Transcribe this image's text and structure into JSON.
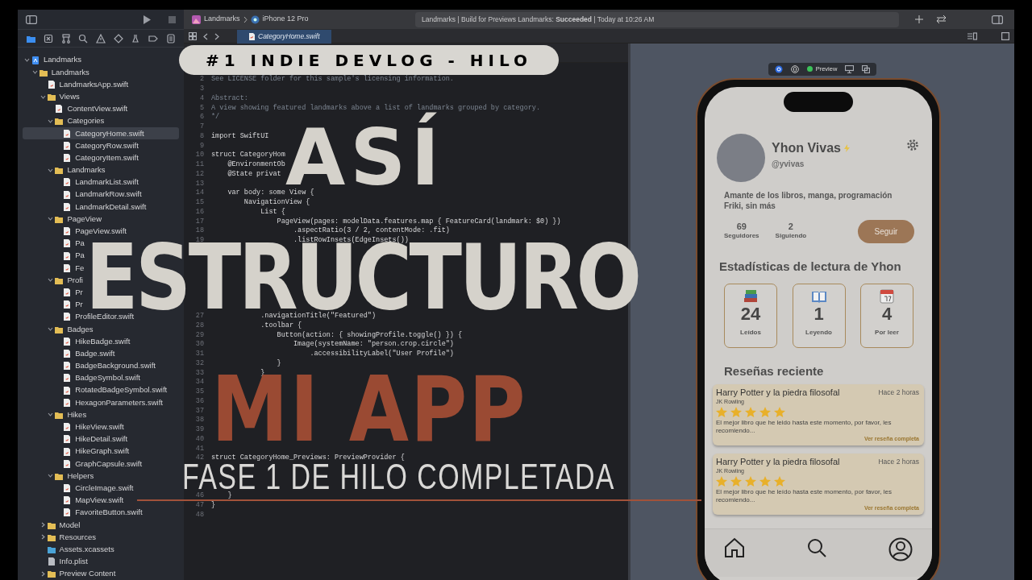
{
  "xcode": {
    "toolbar": {
      "scheme": "Landmarks",
      "device": "iPhone 12 Pro",
      "status": "Landmarks | Build for Previews Landmarks: **Succeeded** | Today at 10:26 AM"
    },
    "navigator": {
      "tree": [
        {
          "name": "Landmarks",
          "kind": "project",
          "expanded": true,
          "selected": false,
          "children": [
            {
              "name": "Landmarks",
              "kind": "folder",
              "expanded": true,
              "selected": false,
              "children": [
                {
                  "name": "LandmarksApp.swift",
                  "kind": "swift",
                  "selected": false
                },
                {
                  "name": "Views",
                  "kind": "folder",
                  "expanded": true,
                  "selected": false,
                  "children": [
                    {
                      "name": "ContentView.swift",
                      "kind": "swift",
                      "selected": false
                    },
                    {
                      "name": "Categories",
                      "kind": "folder",
                      "expanded": true,
                      "selected": false,
                      "children": [
                        {
                          "name": "CategoryHome.swift",
                          "kind": "swift",
                          "selected": true
                        },
                        {
                          "name": "CategoryRow.swift",
                          "kind": "swift",
                          "selected": false
                        },
                        {
                          "name": "CategoryItem.swift",
                          "kind": "swift",
                          "selected": false
                        }
                      ]
                    },
                    {
                      "name": "Landmarks",
                      "kind": "folder",
                      "expanded": true,
                      "selected": false,
                      "children": [
                        {
                          "name": "LandmarkList.swift",
                          "kind": "swift",
                          "selected": false
                        },
                        {
                          "name": "LandmarkRow.swift",
                          "kind": "swift",
                          "selected": false
                        },
                        {
                          "name": "LandmarkDetail.swift",
                          "kind": "swift",
                          "selected": false
                        }
                      ]
                    },
                    {
                      "name": "PageView",
                      "kind": "folder",
                      "expanded": true,
                      "selected": false,
                      "children": [
                        {
                          "name": "PageView.swift",
                          "kind": "swift",
                          "selected": false
                        },
                        {
                          "name": "Pa",
                          "kind": "swift",
                          "selected": false
                        },
                        {
                          "name": "Pa",
                          "kind": "swift",
                          "selected": false
                        },
                        {
                          "name": "Fe",
                          "kind": "swift",
                          "selected": false
                        }
                      ]
                    },
                    {
                      "name": "Profi",
                      "kind": "folder",
                      "expanded": true,
                      "selected": false,
                      "children": [
                        {
                          "name": "Pr",
                          "kind": "swift",
                          "selected": false
                        },
                        {
                          "name": "Pr",
                          "kind": "swift",
                          "selected": false
                        },
                        {
                          "name": "ProfileEditor.swift",
                          "kind": "swift",
                          "selected": false
                        }
                      ]
                    },
                    {
                      "name": "Badges",
                      "kind": "folder",
                      "expanded": true,
                      "selected": false,
                      "children": [
                        {
                          "name": "HikeBadge.swift",
                          "kind": "swift",
                          "selected": false
                        },
                        {
                          "name": "Badge.swift",
                          "kind": "swift",
                          "selected": false
                        },
                        {
                          "name": "BadgeBackground.swift",
                          "kind": "swift",
                          "selected": false
                        },
                        {
                          "name": "BadgeSymbol.swift",
                          "kind": "swift",
                          "selected": false
                        },
                        {
                          "name": "RotatedBadgeSymbol.swift",
                          "kind": "swift",
                          "selected": false
                        },
                        {
                          "name": "HexagonParameters.swift",
                          "kind": "swift",
                          "selected": false
                        }
                      ]
                    },
                    {
                      "name": "Hikes",
                      "kind": "folder",
                      "expanded": true,
                      "selected": false,
                      "children": [
                        {
                          "name": "HikeView.swift",
                          "kind": "swift",
                          "selected": false
                        },
                        {
                          "name": "HikeDetail.swift",
                          "kind": "swift",
                          "selected": false
                        },
                        {
                          "name": "HikeGraph.swift",
                          "kind": "swift",
                          "selected": false
                        },
                        {
                          "name": "GraphCapsule.swift",
                          "kind": "swift",
                          "selected": false
                        }
                      ]
                    },
                    {
                      "name": "Helpers",
                      "kind": "folder",
                      "expanded": true,
                      "selected": false,
                      "children": [
                        {
                          "name": "CircleImage.swift",
                          "kind": "swift",
                          "selected": false
                        },
                        {
                          "name": "MapView.swift",
                          "kind": "swift",
                          "selected": false
                        },
                        {
                          "name": "FavoriteButton.swift",
                          "kind": "swift",
                          "selected": false
                        }
                      ]
                    }
                  ]
                },
                {
                  "name": "Model",
                  "kind": "folder",
                  "expanded": false,
                  "selected": false
                },
                {
                  "name": "Resources",
                  "kind": "folder",
                  "expanded": false,
                  "selected": false
                },
                {
                  "name": "Assets.xcassets",
                  "kind": "assets",
                  "selected": false
                },
                {
                  "name": "Info.plist",
                  "kind": "plist",
                  "selected": false
                },
                {
                  "name": "Preview Content",
                  "kind": "folder",
                  "expanded": false,
                  "selected": false
                }
              ]
            }
          ]
        }
      ]
    },
    "editor": {
      "tabs": [
        {
          "label": "CategoryHome.swift",
          "selected": true
        }
      ],
      "lines": [
        {
          "n": "2",
          "kind": "comment",
          "code": "See LICENSE folder for this sample's licensing information."
        },
        {
          "n": "3"
        },
        {
          "n": "4",
          "kind": "comment",
          "code": "Abstract:"
        },
        {
          "n": "5",
          "kind": "comment",
          "code": "A view showing featured landmarks above a list of landmarks grouped by category."
        },
        {
          "n": "6",
          "kind": "comment",
          "code": "*/"
        },
        {
          "n": "7"
        },
        {
          "n": "8",
          "kind": "code",
          "code": "import SwiftUI"
        },
        {
          "n": "9"
        },
        {
          "n": "10",
          "kind": "code",
          "code": "struct CategoryHom"
        },
        {
          "n": "11",
          "kind": "code",
          "code": "    @EnvironmentOb"
        },
        {
          "n": "12",
          "kind": "code",
          "code": "    @State privat"
        },
        {
          "n": "13"
        },
        {
          "n": "14",
          "kind": "code",
          "code": "    var body: some View {"
        },
        {
          "n": "15",
          "kind": "code",
          "code": "        NavigationView {"
        },
        {
          "n": "16",
          "kind": "code",
          "code": "            List {"
        },
        {
          "n": "17",
          "kind": "code",
          "code": "                PageView(pages: modelData.features.map { FeatureCard(landmark: $0) })"
        },
        {
          "n": "18",
          "kind": "code",
          "code": "                    .aspectRatio(3 / 2, contentMode: .fit)"
        },
        {
          "n": "19",
          "kind": "code",
          "code": "                    .listRowInsets(EdgeInsets())"
        },
        {
          "kind": "covered"
        },
        {
          "kind": "covered"
        },
        {
          "kind": "covered"
        },
        {
          "kind": "covered"
        },
        {
          "kind": "covered"
        },
        {
          "kind": "covered"
        },
        {
          "kind": "covered"
        },
        {
          "n": "27",
          "kind": "code",
          "code": "            .navigationTitle(\"Featured\")"
        },
        {
          "n": "28",
          "kind": "code",
          "code": "            .toolbar {"
        },
        {
          "n": "29",
          "kind": "code",
          "code": "                Button(action: { showingProfile.toggle() }) {"
        },
        {
          "n": "30",
          "kind": "code",
          "code": "                    Image(systemName: \"person.crop.circle\")"
        },
        {
          "n": "31",
          "kind": "code",
          "code": "                        .accessibilityLabel(\"User Profile\")"
        },
        {
          "n": "32",
          "kind": "code",
          "code": "                }"
        },
        {
          "n": "33",
          "kind": "code",
          "code": "            }"
        },
        {
          "n": "34"
        },
        {
          "n": "35"
        },
        {
          "n": "36"
        },
        {
          "n": "37"
        },
        {
          "n": "38"
        },
        {
          "n": "39"
        },
        {
          "n": "40"
        },
        {
          "n": "41"
        },
        {
          "n": "42",
          "kind": "code",
          "code": "struct CategoryHome_Previews: PreviewProvider {"
        },
        {
          "kind": "covered"
        },
        {
          "kind": "covered"
        },
        {
          "kind": "covered"
        },
        {
          "n": "46",
          "kind": "code",
          "code": "    }"
        },
        {
          "n": "47",
          "kind": "code",
          "code": "}"
        },
        {
          "n": "48"
        }
      ]
    },
    "preview": {
      "mode_label": "Preview",
      "app": {
        "name": "Yhon Vivas",
        "handle": "@yvivas",
        "bio": [
          "Amante de los libros, manga, programación",
          "Friki, sin más"
        ],
        "counts": [
          {
            "value": "69",
            "label": "Seguidores"
          },
          {
            "value": "2",
            "label": "Siguiendo"
          }
        ],
        "follow": "Seguir",
        "stats_title": "Estadísticas de lectura de Yhon",
        "stats": [
          {
            "kind": "books",
            "value": "24",
            "label": "Leídos"
          },
          {
            "kind": "open-book",
            "value": "1",
            "label": "Leyendo"
          },
          {
            "kind": "calendar",
            "value": "4",
            "label": "Por leer"
          }
        ],
        "reviews_title": "Reseñas reciente",
        "reviews": [
          {
            "title": "Harry Potter y la piedra filosofal",
            "time": "Hace 2 horas",
            "author": "JK Rowling",
            "stars": 5,
            "text": "El mejor libro que he leido hasta este momento, por favor, les recomiendo...",
            "link": "Ver reseña completa"
          },
          {
            "title": "Harry Potter y la piedra filosofal",
            "time": "Hace 2 horas",
            "author": "JK Rowling",
            "stars": 5,
            "text": "El mejor libro que he leído hasta este momento, por favor, les recomiendo...",
            "link": "Ver reseña completa"
          }
        ]
      }
    }
  },
  "overlay": {
    "banner": "#1 INDIE DEVLOG - HILO",
    "title_lines": [
      {
        "text": "ASÍ",
        "kind": "light"
      },
      {
        "text": "ESTRUCTURO",
        "kind": "light"
      },
      {
        "text": "MI APP",
        "kind": "accent"
      }
    ],
    "subtitle": "FASE 1 DE HILO COMPLETADA"
  }
}
